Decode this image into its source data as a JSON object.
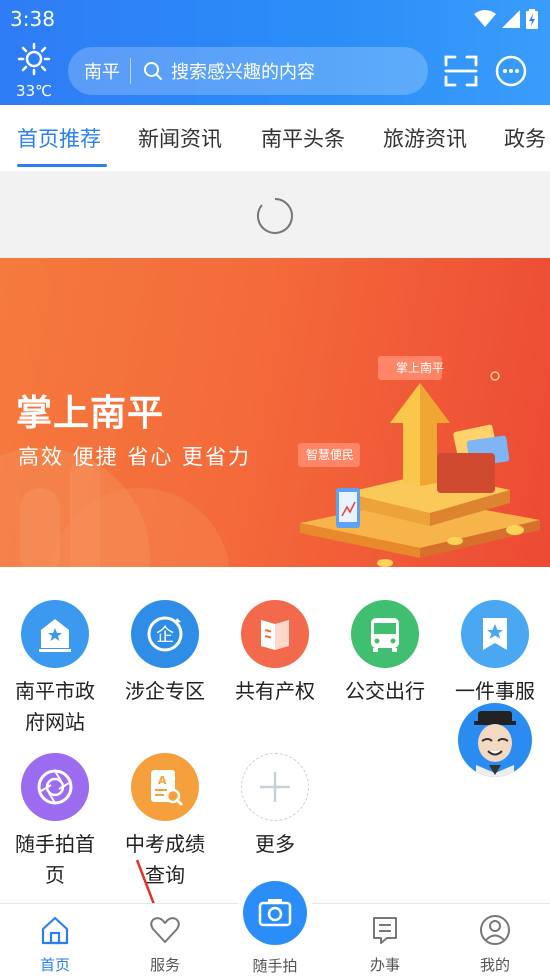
{
  "status_bar": {
    "time": "3:38"
  },
  "header": {
    "weather": {
      "temperature": "33℃",
      "icon": "sun-icon"
    },
    "search": {
      "city": "南平",
      "placeholder": "搜索感兴趣的内容"
    },
    "actions": [
      "scan-icon",
      "message-icon"
    ]
  },
  "tabs": [
    {
      "label": "首页推荐",
      "active": true
    },
    {
      "label": "新闻资讯",
      "active": false
    },
    {
      "label": "南平头条",
      "active": false
    },
    {
      "label": "旅游资讯",
      "active": false
    },
    {
      "label": "政务",
      "active": false
    }
  ],
  "banner": {
    "title": "掌上南平",
    "subtitle": "高效 便捷 省心 更省力",
    "tag_left": "智慧便民",
    "tag_right": "掌上南平"
  },
  "services": [
    {
      "label": "南平市政府网站",
      "icon": "government-building-icon",
      "color": "#3b9af0"
    },
    {
      "label": "涉企专区",
      "icon": "enterprise-icon",
      "color": "#2f8de8"
    },
    {
      "label": "共有产权",
      "icon": "property-book-icon",
      "color": "#f26a4b"
    },
    {
      "label": "公交出行",
      "icon": "bus-icon",
      "color": "#3fbf6f"
    },
    {
      "label": "一件事服",
      "icon": "bookmark-star-icon",
      "color": "#4aa8f2"
    },
    {
      "label": "随手拍首页",
      "icon": "camera-aperture-icon",
      "color": "#9b6cf0"
    },
    {
      "label": "中考成绩查询",
      "icon": "score-query-icon",
      "color": "#f5a03c"
    },
    {
      "label": "更多",
      "icon": "plus-icon",
      "color": "#c8d0d8"
    }
  ],
  "bottom_nav": [
    {
      "label": "首页",
      "icon": "home-icon",
      "active": true
    },
    {
      "label": "服务",
      "icon": "heart-icon",
      "active": false
    },
    {
      "label": "随手拍",
      "icon": "camera-icon",
      "active": false
    },
    {
      "label": "办事",
      "icon": "document-icon",
      "active": false
    },
    {
      "label": "我的",
      "icon": "profile-icon",
      "active": false
    }
  ],
  "colors": {
    "accent": "#2b7ff0",
    "header_blue": "#2b8ef8",
    "banner_orange": "#f46a3a"
  }
}
